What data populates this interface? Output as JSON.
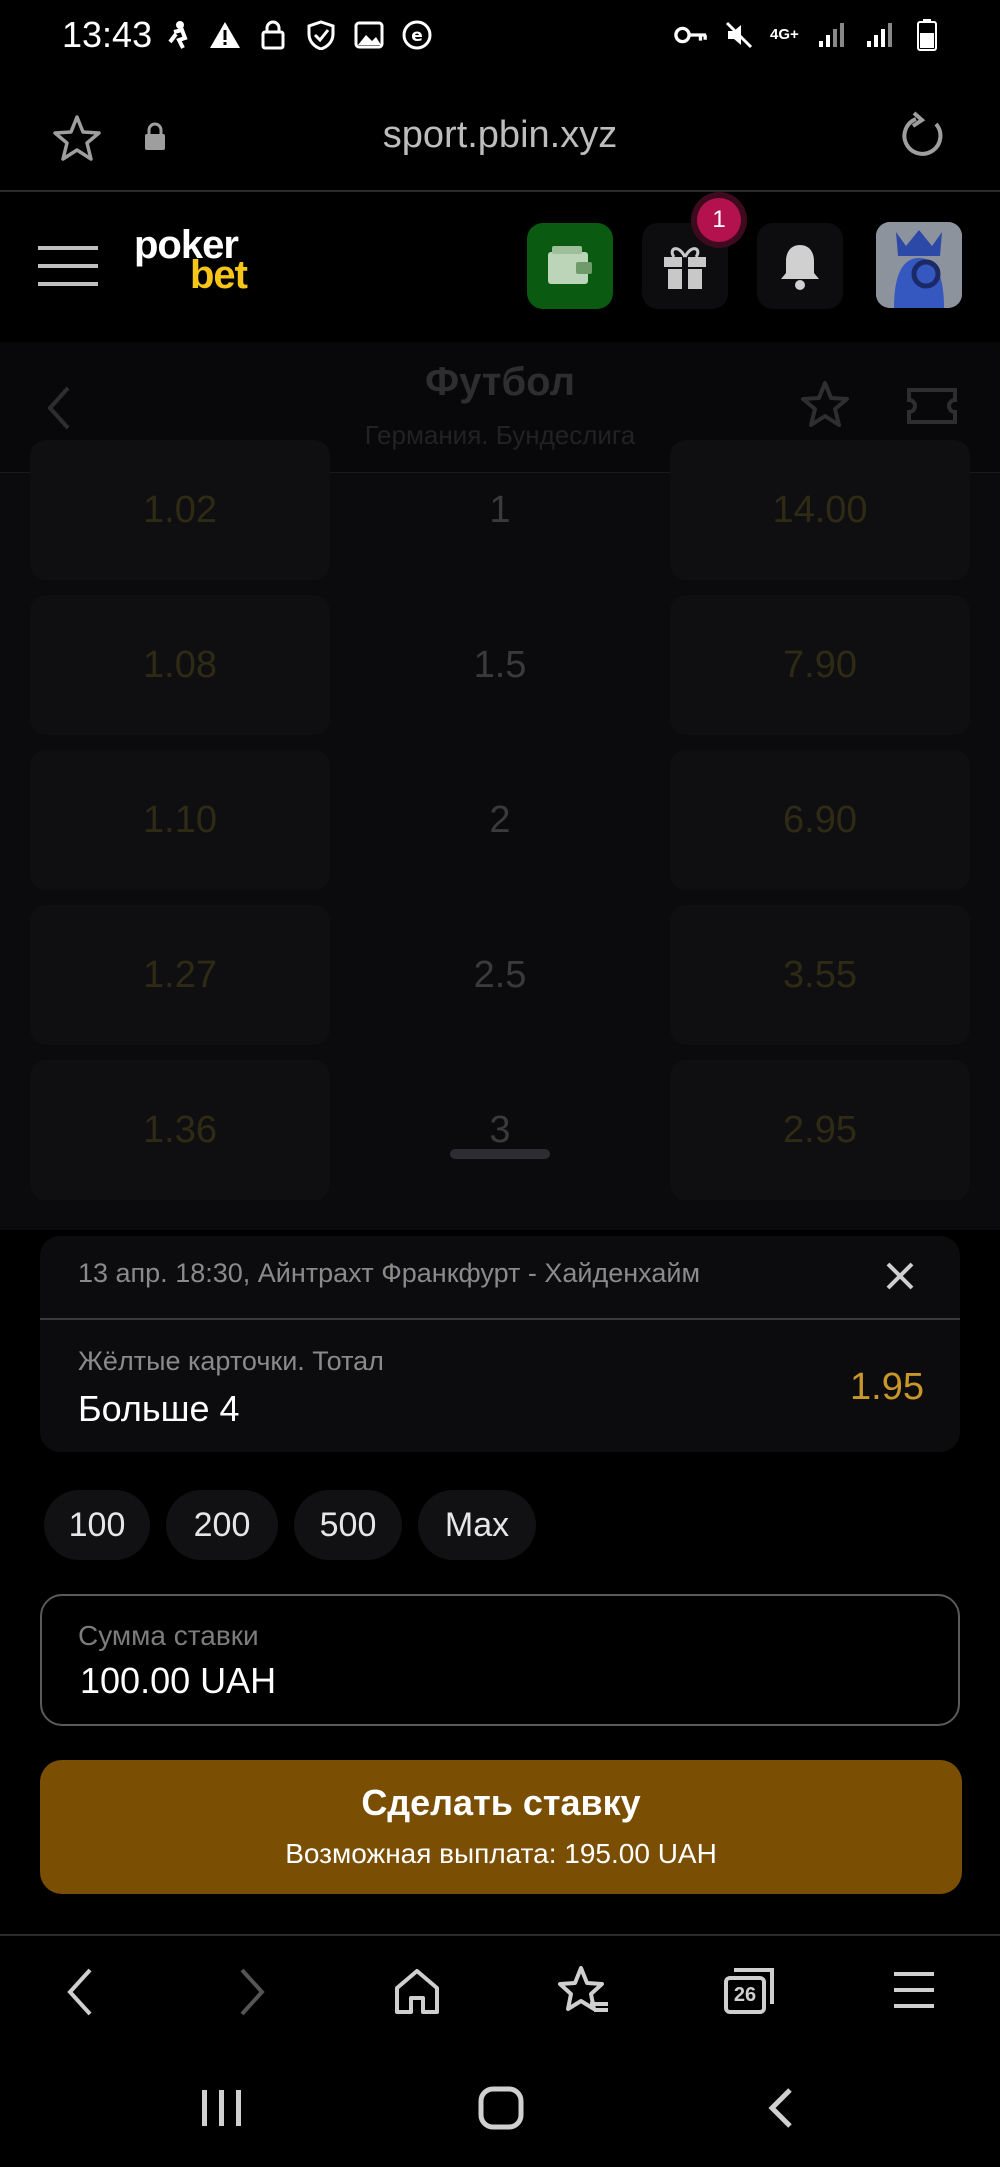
{
  "status_bar": {
    "time": "13:43",
    "network": "4G+"
  },
  "browser": {
    "url": "sport.pbin.xyz",
    "tabs_count": "26"
  },
  "header": {
    "logo_top": "poker",
    "logo_bottom": "bet",
    "gift_badge": "1"
  },
  "page": {
    "title": "Футбол",
    "subtitle": "Германия. Бундеслига"
  },
  "odds_rows": [
    {
      "left": "1.02",
      "mid": "1",
      "right": "14.00"
    },
    {
      "left": "1.08",
      "mid": "1.5",
      "right": "7.90"
    },
    {
      "left": "1.10",
      "mid": "2",
      "right": "6.90"
    },
    {
      "left": "1.27",
      "mid": "2.5",
      "right": "3.55"
    },
    {
      "left": "1.36",
      "mid": "3",
      "right": "2.95"
    }
  ],
  "bet_slip": {
    "event": "13 апр. 18:30, Айнтрахт Франкфурт - Хайденхайм",
    "market": "Жёлтые карточки. Тотал",
    "selection": "Больше 4",
    "odds": "1.95",
    "quick_amounts": [
      "100",
      "200",
      "500",
      "Max"
    ],
    "stake_label": "Сумма ставки",
    "stake_value": "100.00 UAH",
    "submit_label": "Сделать ставку",
    "payout_text": "Возможная выплата: 195.00 UAH"
  },
  "colors": {
    "accent_gold": "#c9962a",
    "bet_button": "#7a4f04",
    "wallet_green": "#0a5a12",
    "badge": "#b3124e"
  }
}
